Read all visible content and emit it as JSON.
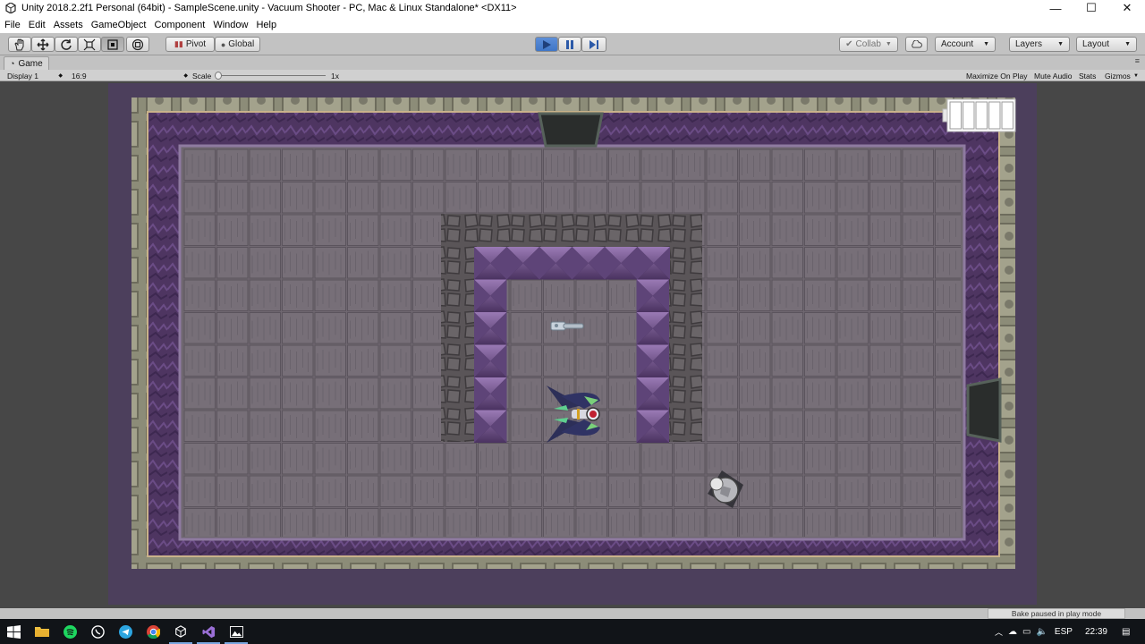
{
  "window": {
    "title": "Unity 2018.2.2f1 Personal (64bit) - SampleScene.unity - Vacuum Shooter - PC, Mac & Linux Standalone* <DX11>",
    "minimize_glyph": "—",
    "maximize_glyph": "☐",
    "close_glyph": "✕"
  },
  "menu": [
    "File",
    "Edit",
    "Assets",
    "GameObject",
    "Component",
    "Window",
    "Help"
  ],
  "toolbar": {
    "tools": [
      "hand-tool",
      "move-tool",
      "rotate-tool",
      "scale-tool",
      "rect-tool",
      "transform-tool"
    ],
    "active_tool": "rect-tool",
    "pivot_label": "Pivot",
    "global_label": "Global",
    "collab_label": "Collab",
    "account_label": "Account",
    "layers_label": "Layers",
    "layout_label": "Layout",
    "play_state": "playing",
    "accent_color": "#3f76c7"
  },
  "game_tab": {
    "label": "Game",
    "display": "Display 1",
    "aspect": "16:9",
    "scale_label": "Scale",
    "scale_value": "1x",
    "maximize_on_play": "Maximize On Play",
    "mute_audio": "Mute Audio",
    "stats": "Stats",
    "gizmos": "Gizmos"
  },
  "game": {
    "floor_color": "#6e6670",
    "wall_color": "#5a3f6e",
    "spike_color": "#7a5a94",
    "ammo_slots": 5
  },
  "status": {
    "bake_text": "Bake paused in play mode"
  },
  "taskbar": {
    "language": "ESP",
    "time": "22:39",
    "apps": [
      "start-icon",
      "file-explorer-icon",
      "spotify-icon",
      "whatsapp-icon",
      "telegram-icon",
      "chrome-icon",
      "unity-icon",
      "visual-studio-icon",
      "photos-icon"
    ]
  }
}
